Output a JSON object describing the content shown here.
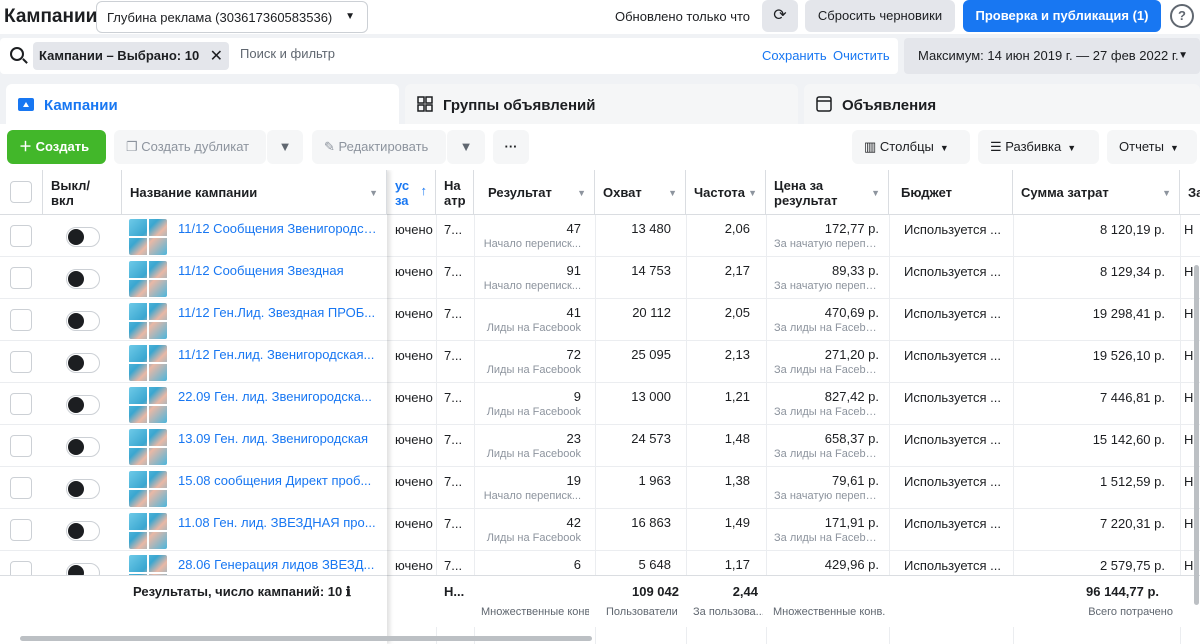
{
  "header": {
    "title": "Кампании",
    "account": "Глубина реклама (303617360583536)",
    "updated": "Обновлено только что",
    "discard": "Сбросить черновики",
    "publish": "Проверка и публикация (1)",
    "help": "?"
  },
  "filter": {
    "chip": "Кампании – Выбрано: 10",
    "placeholder": "Поиск и фильтр",
    "save": "Сохранить",
    "clear": "Очистить",
    "date_range": "Максимум: 14 июн 2019 г. — 27 фев 2022 г."
  },
  "tabs": [
    {
      "label": "Кампании"
    },
    {
      "label": "Группы объявлений"
    },
    {
      "label": "Объявления"
    }
  ],
  "toolbar": {
    "create": "Создать",
    "duplicate": "Создать дубликат",
    "edit": "Редактировать",
    "more": "···",
    "columns": "Столбцы",
    "breakdown": "Разбивка",
    "reports": "Отчеты"
  },
  "columns": {
    "toggle": "Выкл/\nвкл",
    "name": "Название кампании",
    "status": "ус\nза",
    "attr": "На\nатр",
    "result": "Результат",
    "reach": "Охват",
    "freq": "Частота",
    "cpr": "Цена за\nрезультат",
    "budget": "Бюджет",
    "spend": "Сумма затрат",
    "last": "За"
  },
  "rows": [
    {
      "name": "11/12 Сообщения Звенигородск...",
      "status": "ючено",
      "attr": "7...",
      "result": "47",
      "result_type": "Начало переписк...",
      "reach": "13 480",
      "freq": "2,06",
      "cpr": "172,77 р.",
      "cpr_type": "За начатую перепи...",
      "budget": "Используется ...",
      "spend": "8 120,19 р.",
      "last": "Н"
    },
    {
      "name": "11/12 Сообщения Звездная",
      "status": "ючено",
      "attr": "7...",
      "result": "91",
      "result_type": "Начало переписк...",
      "reach": "14 753",
      "freq": "2,17",
      "cpr": "89,33 р.",
      "cpr_type": "За начатую перепи...",
      "budget": "Используется ...",
      "spend": "8 129,34 р.",
      "last": "Н"
    },
    {
      "name": "11/12 Ген.Лид. Звездная ПРОБ...",
      "status": "ючено",
      "attr": "7...",
      "result": "41",
      "result_type": "Лиды на Facebook",
      "reach": "20 112",
      "freq": "2,05",
      "cpr": "470,69 р.",
      "cpr_type": "За лиды на Facebo...",
      "budget": "Используется ...",
      "spend": "19 298,41 р.",
      "last": "Н"
    },
    {
      "name": "11/12 Ген.лид. Звенигородская...",
      "status": "ючено",
      "attr": "7...",
      "result": "72",
      "result_type": "Лиды на Facebook",
      "reach": "25 095",
      "freq": "2,13",
      "cpr": "271,20 р.",
      "cpr_type": "За лиды на Facebo...",
      "budget": "Используется ...",
      "spend": "19 526,10 р.",
      "last": "Н"
    },
    {
      "name": "22.09 Ген. лид. Звенигородска...",
      "status": "ючено",
      "attr": "7...",
      "result": "9",
      "result_type": "Лиды на Facebook",
      "reach": "13 000",
      "freq": "1,21",
      "cpr": "827,42 р.",
      "cpr_type": "За лиды на Facebo...",
      "budget": "Используется ...",
      "spend": "7 446,81 р.",
      "last": "Н"
    },
    {
      "name": "13.09 Ген. лид. Звенигородская",
      "status": "ючено",
      "attr": "7...",
      "result": "23",
      "result_type": "Лиды на Facebook",
      "reach": "24 573",
      "freq": "1,48",
      "cpr": "658,37 р.",
      "cpr_type": "За лиды на Facebo...",
      "budget": "Используется ...",
      "spend": "15 142,60 р.",
      "last": "Н"
    },
    {
      "name": "15.08 сообщения Директ проб...",
      "status": "ючено",
      "attr": "7...",
      "result": "19",
      "result_type": "Начало переписк...",
      "reach": "1 963",
      "freq": "1,38",
      "cpr": "79,61 р.",
      "cpr_type": "За начатую перепи...",
      "budget": "Используется ...",
      "spend": "1 512,59 р.",
      "last": "Н"
    },
    {
      "name": "11.08 Ген. лид. ЗВЕЗДНАЯ про...",
      "status": "ючено",
      "attr": "7...",
      "result": "42",
      "result_type": "Лиды на Facebook",
      "reach": "16 863",
      "freq": "1,49",
      "cpr": "171,91 р.",
      "cpr_type": "За лиды на Facebo...",
      "budget": "Используется ...",
      "spend": "7 220,31 р.",
      "last": "Н"
    },
    {
      "name": "28.06 Генерация лидов ЗВЕЗД...",
      "status": "ючено",
      "attr": "7...",
      "result": "6",
      "result_type": "",
      "reach": "5 648",
      "freq": "1,17",
      "cpr": "429,96 р.",
      "cpr_type": "",
      "budget": "Используется ...",
      "spend": "2 579,75 р.",
      "last": "Н"
    }
  ],
  "totals": {
    "label": "Результаты, число кампаний: 10",
    "attr": "Н...",
    "result_sub": "Множественные конв...",
    "reach": "109 042",
    "reach_sub": "Пользователи",
    "freq": "2,44",
    "freq_sub": "За пользова...",
    "cpr_sub": "Множественные конв...",
    "spend": "96 144,77 р.",
    "spend_sub": "Всего потрачено"
  },
  "colors": {
    "accent": "#1877f2",
    "create": "#42b72a"
  }
}
